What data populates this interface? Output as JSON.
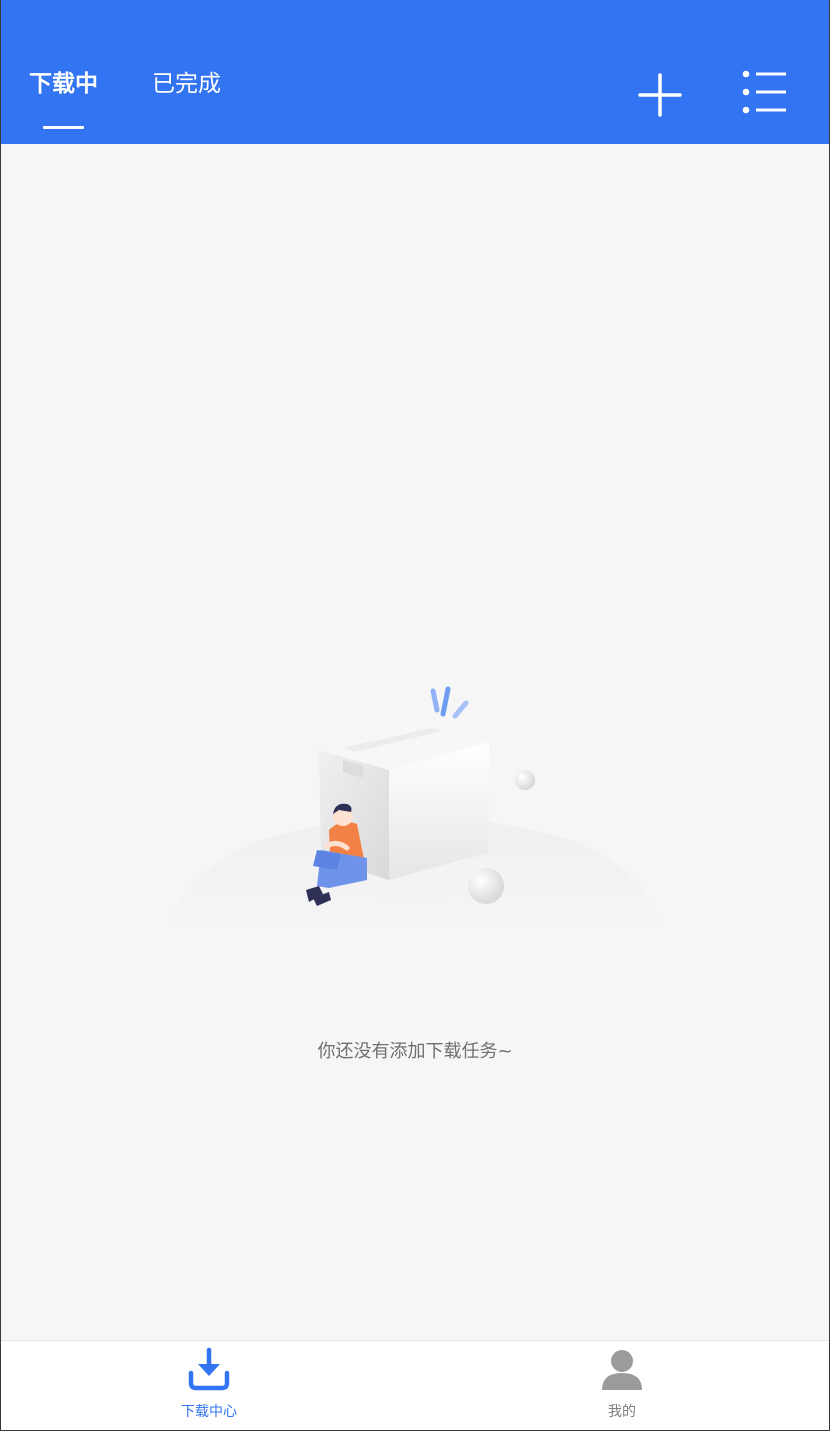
{
  "header": {
    "tabs": [
      {
        "label": "下载中",
        "active": true
      },
      {
        "label": "已完成",
        "active": false
      }
    ],
    "actions": {
      "add_icon": "plus-icon",
      "menu_icon": "list-menu-icon"
    }
  },
  "empty_state": {
    "illustration": "empty-box-illustration",
    "message": "你还没有添加下载任务~"
  },
  "bottom_nav": {
    "items": [
      {
        "label": "下载中心",
        "icon": "download-icon",
        "active": true
      },
      {
        "label": "我的",
        "icon": "user-icon",
        "active": false
      }
    ]
  },
  "colors": {
    "primary": "#3274f2",
    "background": "#f6f6f7",
    "text_muted": "#6f6f6f",
    "nav_inactive": "#7d7d7d"
  }
}
